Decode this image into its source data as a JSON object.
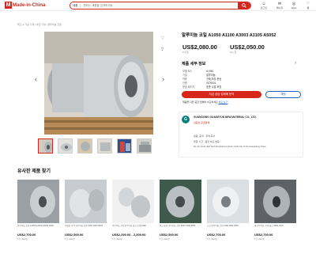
{
  "header": {
    "logo_mark": "M",
    "logo_text": "Made-in-China",
    "search_scope": "제품",
    "search_placeholder": "원하는 제품을 검색하세요",
    "icons": [
      {
        "icon": "user-icon",
        "label": "로그인"
      },
      {
        "icon": "chat-icon",
        "label": "메시지"
      },
      {
        "icon": "globe-icon",
        "label": "Apps"
      },
      {
        "icon": "heart-icon",
        "label": "찜"
      }
    ]
  },
  "breadcrumb": "제조 & 가공 기계 › 야금 기계 › 알루미늄 코일",
  "product": {
    "title": "알루미늄 코일 A1050 A1100 A3003 A3105 A5052",
    "price1": "US$2,080.00",
    "price1_label": "5-9 톤",
    "price2": "US$2,050.00",
    "price2_label": "10+ 톤",
    "specs_title": "제품 세부 정보",
    "specs": [
      {
        "k": "모델 NO.",
        "v": "A1050"
      },
      {
        "k": "기질",
        "v": "알루미늄"
      },
      {
        "k": "적용",
        "v": "건축,포장,운송"
      },
      {
        "k": "인증",
        "v": "ISO9001"
      },
      {
        "k": "운송 패키지",
        "v": "표준 수출 포장"
      },
      {
        "k": "생산",
        "v": "알루미늄 코일, 알루미늄 호일, 기타 알루미늄 제품"
      }
    ],
    "contact_btn": "지금 공급 업체에 문의",
    "chat_btn": "채팅",
    "compare_text": "제품을 다른 공급 업체와 비교하세요",
    "compare_link": "비교 보기"
  },
  "supplier": {
    "logo_letter": "G",
    "name": "GUANGXING GUANGYUN NEW MATERIAL CO., LTD.",
    "badge": "검증된 공급업체",
    "info": [
      "광동, 중국 · 무역 회사",
      "방문 시간 · 응답 속도 높음",
      "No. 41 Yunfu High Tech Development Zone Yunfu City Yunfu Guangdong China"
    ]
  },
  "similar": {
    "title": "유사한 제품 찾기",
    "items": [
      {
        "desc": "알루미늄 코일 A1050 A1100 A3003 3003",
        "price": "US$2,700.00",
        "moq": "5 톤 (MOQ)"
      },
      {
        "desc": "저렴한 가격 알루미늄 코일 1050 1060 3003",
        "price": "US$2,500.00",
        "moq": "5 톤 (MOQ)"
      },
      {
        "desc": "알루미늄 코일 알루미늄 합금 코일 1060",
        "price": "US$2,290.00 - 2,300.00",
        "moq": "5 톤 (MOQ)"
      },
      {
        "desc": "최고 품질 알루미늄 코일 3003 3105 5052",
        "price": "US$2,500.00",
        "moq": "5 톤 (MOQ)"
      },
      {
        "desc": "도금 알루미늄 코일 1100 3003 5052",
        "price": "US$2,700.00",
        "moq": "5 톤 (MOQ)"
      },
      {
        "desc": "롤 알루미늄 코일 합금 1060 1100",
        "price": "US$2,700.00",
        "moq": "5 톤 (MOQ)"
      }
    ]
  },
  "colors": {
    "brand": "#d7261c",
    "link": "#1f5fbf"
  }
}
